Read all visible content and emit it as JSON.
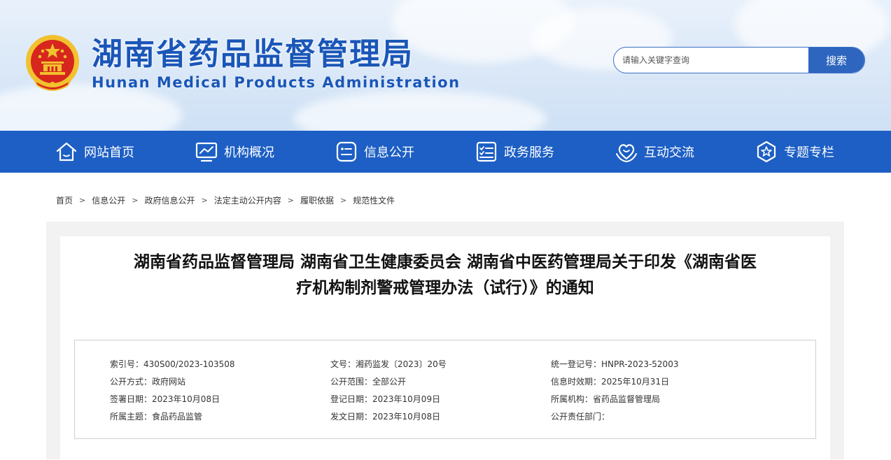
{
  "header": {
    "title": "湖南省药品监督管理局",
    "subtitle": "Hunan Medical Products Administration",
    "search": {
      "placeholder": "请输入关键字查询",
      "button_label": "搜索"
    }
  },
  "nav": {
    "items": [
      {
        "label": "网站首页",
        "icon": "home-icon"
      },
      {
        "label": "机构概况",
        "icon": "chart-monitor-icon"
      },
      {
        "label": "信息公开",
        "icon": "info-list-icon"
      },
      {
        "label": "政务服务",
        "icon": "checklist-icon"
      },
      {
        "label": "互动交流",
        "icon": "heart-hands-icon"
      },
      {
        "label": "专题专栏",
        "icon": "star-badge-icon"
      }
    ]
  },
  "breadcrumb": {
    "items": [
      "首页",
      "信息公开",
      "政府信息公开",
      "法定主动公开内容",
      "履职依据",
      "规范性文件"
    ],
    "separator": ">"
  },
  "article": {
    "title_line1": "湖南省药品监督管理局 湖南省卫生健康委员会 湖南省中医药管理局关于印发《湖南省医",
    "title_line2": "疗机构制剂警戒管理办法（试行）》的通知"
  },
  "meta": {
    "rows": [
      [
        "索引号：430S00/2023-103508",
        "文号：湘药监发〔2023〕20号",
        "统一登记号：HNPR-2023-52003"
      ],
      [
        "公开方式：政府网站",
        "公开范围：全部公开",
        "信息时效期：2025年10月31日"
      ],
      [
        "签署日期：2023年10月08日",
        "登记日期：2023年10月09日",
        "所属机构：省药品监督管理局"
      ],
      [
        "所属主题：食品药品监管",
        "发文日期：2023年10月08日",
        "公开责任部门："
      ]
    ]
  },
  "colors": {
    "brand_blue": "#1d5fc4",
    "title_blue": "#1a56b8",
    "emblem_red": "#d7261e",
    "emblem_gold": "#f2c12e"
  }
}
